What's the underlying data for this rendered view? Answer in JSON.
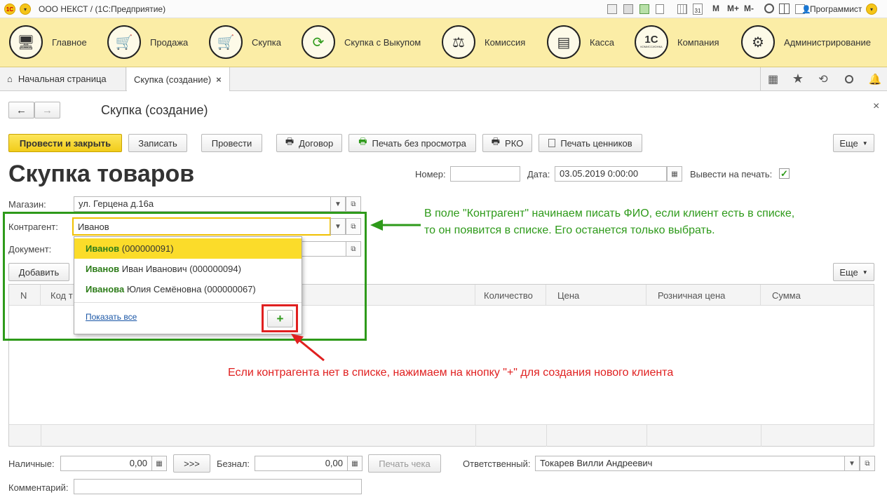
{
  "titlebar": {
    "app_title": "ООО НЕКСТ / (1С:Предприятие)",
    "btn_m": "M",
    "btn_mplus": "M+",
    "btn_mminus": "M-",
    "calendar_day": "31",
    "user": "Программист"
  },
  "sections": [
    {
      "label": "Главное"
    },
    {
      "label": "Продажа"
    },
    {
      "label": "Скупка"
    },
    {
      "label": "Скупка с Выкупом"
    },
    {
      "label": "Комиссия"
    },
    {
      "label": "Касса"
    },
    {
      "label": "Компания",
      "logo": "1С",
      "logo_sub": "КОМИССИОНКА"
    },
    {
      "label": "Администрирование"
    }
  ],
  "tabs": {
    "home": "Начальная страница",
    "active": "Скупка (создание)",
    "close": "×"
  },
  "form": {
    "nav_title": "Скупка (создание)",
    "close": "×",
    "heading": "Скупка товаров"
  },
  "toolbar": {
    "post_close": "Провести и закрыть",
    "save": "Записать",
    "post": "Провести",
    "contract": "Договор",
    "print_no_preview": "Печать без просмотра",
    "rko": "РКО",
    "print_tags": "Печать ценников",
    "more": "Еще"
  },
  "header": {
    "number_label": "Номер:",
    "number_value": "",
    "date_label": "Дата:",
    "date_value": "03.05.2019  0:00:00",
    "print_label": "Вывести на печать:"
  },
  "fields": {
    "shop_label": "Магазин:",
    "shop_value": "ул. Герцена д.16а",
    "counterparty_label": "Контрагент:",
    "counterparty_value": "Иванов",
    "document_label": "Документ:"
  },
  "dropdown": {
    "items": [
      {
        "match": "Иванов",
        "rest": " (000000091)"
      },
      {
        "match": "Иванов",
        "rest": " Иван Иванович (000000094)"
      },
      {
        "match": "Иванова",
        "rest": "  Юлия Семёновна (000000067)"
      }
    ],
    "show_all": "Показать все",
    "add": "+"
  },
  "table": {
    "add_button": "Добавить",
    "more": "Еще",
    "columns": [
      "N",
      "Код т",
      "Количество",
      "Цена",
      "Розничная цена",
      "Сумма"
    ]
  },
  "footer": {
    "cash_label": "Наличные:",
    "cash_value": "0,00",
    "transfer_button": ">>>",
    "noncash_label": "Безнал:",
    "noncash_value": "0,00",
    "print_receipt": "Печать чека",
    "responsible_label": "Ответственный:",
    "responsible_value": "Токарев Вилли Андреевич",
    "comment_label": "Комментарий:",
    "comment_value": ""
  },
  "annotations": {
    "green_text_line1": "В поле \"Контрагент\" начинаем писать ФИО, если клиент есть в списке,",
    "green_text_line2": "то он появится в списке. Его останется только выбрать.",
    "red_text": "Если контрагента нет в списке, нажимаем на кнопку \"+\" для создания нового клиента"
  },
  "colors": {
    "section_bar": "#fbeda6",
    "primary_button": "#f5d42a",
    "annotation_green": "#2e9a1a",
    "annotation_red": "#e02020",
    "match_highlight": "#2e7d1a"
  }
}
